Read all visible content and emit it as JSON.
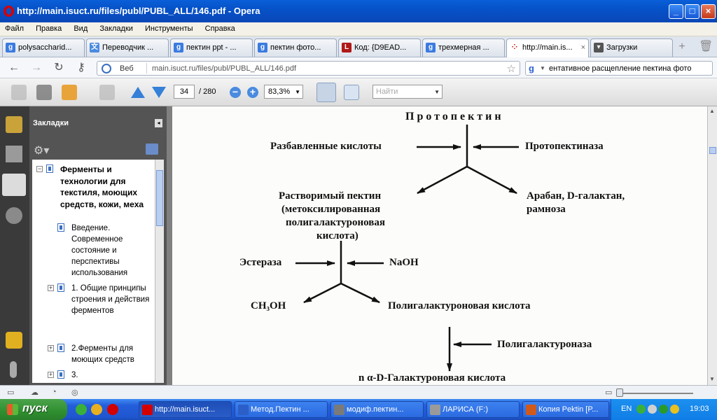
{
  "window": {
    "title": "http://main.isuct.ru/files/publ/PUBL_ALL/146.pdf - Opera"
  },
  "menu": [
    "Файл",
    "Правка",
    "Вид",
    "Закладки",
    "Инструменты",
    "Справка"
  ],
  "tabs": [
    {
      "label": "polysaccharid...",
      "icon": "google-icon"
    },
    {
      "label": "Переводчик ...",
      "icon": "translate-icon"
    },
    {
      "label": "пектин ppt - ...",
      "icon": "google-icon"
    },
    {
      "label": "пектин фото...",
      "icon": "google-icon"
    },
    {
      "label": "Код: {D9EAD...",
      "icon": "code-icon"
    },
    {
      "label": "трехмерная ...",
      "icon": "google-icon"
    },
    {
      "label": "http://main.is...",
      "icon": "page-icon"
    },
    {
      "label": "Загрузки",
      "icon": "downloads-icon"
    }
  ],
  "address": {
    "prefix": "Веб",
    "url": "main.isuct.ru/files/publ/PUBL_ALL/146.pdf"
  },
  "search": {
    "query": "ентативное расщепление пектина фото"
  },
  "pdf_toolbar": {
    "page": "34",
    "page_total": "/ 280",
    "zoom": "83,3%",
    "find_placeholder": "Найти"
  },
  "bookmarks": {
    "header": "Закладки",
    "items": [
      {
        "label": "Ферменты и технологии для текстиля, моющих средств, кожи, меха",
        "expand": "−"
      },
      {
        "label": "Введение. Современное состояние и перспективы использования",
        "expand": ""
      },
      {
        "label": "1. Общие принципы строения и действия ферментов",
        "expand": "+"
      },
      {
        "label": "2.Ферменты для моющих средств",
        "expand": "+"
      },
      {
        "label": "3.",
        "expand": "+"
      }
    ]
  },
  "diagram": {
    "protopectin": "Протопектин",
    "dilute_acids": "Разбавленные кислоты",
    "protopectinase": "Протопектиназа",
    "soluble_pectin": "Растворимый пектин",
    "soluble_pectin_2": "(метоксилированная",
    "soluble_pectin_3": "полигалактуроновая",
    "soluble_pectin_4": "кислота)",
    "araban": "Арабан, D-галактан,",
    "rhamnose": "рамноза",
    "esterase": "Эстераза",
    "naoh": "NaOH",
    "methanol": "CH₃OH",
    "polygalacturonic_acid": "Полигалактуроновая кислота",
    "polygalacturonase": "Полигалактуроназа",
    "product": "n α-D-Галактуроновая кислота"
  },
  "taskbar": {
    "start": "пуск",
    "tasks": [
      {
        "label": "http://main.isuct...",
        "color": "#d40000"
      },
      {
        "label": "Метод.Пектин ...",
        "color": "#2b5fc7"
      },
      {
        "label": "модиф.пектин...",
        "color": "#7a7a7a"
      },
      {
        "label": "ЛАРИСА (F:)",
        "color": "#9a9a9a"
      },
      {
        "label": "Копия Pektin [P...",
        "color": "#d05a1a"
      }
    ],
    "lang": "EN",
    "clock": "19:03"
  }
}
